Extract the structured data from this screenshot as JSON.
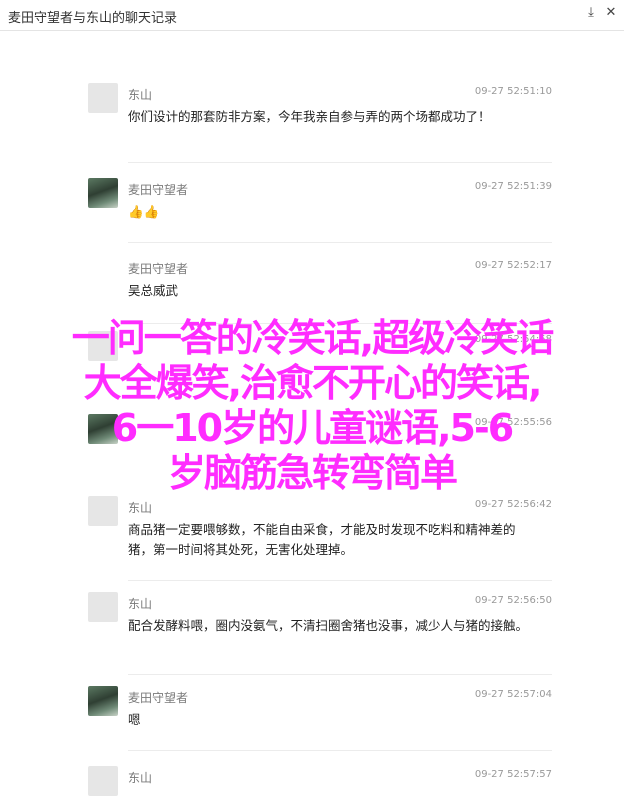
{
  "window": {
    "title": "麦田守望者与东山的聊天记录",
    "min_icon": "minimize-icon",
    "close_icon": "close-icon",
    "min_glyph": "⤓",
    "close_glyph": "✕"
  },
  "messages": [
    {
      "sender": "东山",
      "time": "09-27 52:51:10",
      "avatar": "default",
      "text": "你们设计的那套防非方案，今年我亲自参与弄的两个场都成功了！"
    },
    {
      "sender": "麦田守望者",
      "time": "09-27 52:51:39",
      "avatar": "photo",
      "text": "👍👍"
    },
    {
      "sender": "麦田守望者",
      "time": "09-27 52:52:17",
      "avatar": "none",
      "text": "吴总威武"
    },
    {
      "sender": "",
      "time": "09-27 52:54:58",
      "avatar": "default",
      "text": ""
    },
    {
      "sender": "",
      "time": "09-27 52:55:56",
      "avatar": "photo",
      "text": ""
    },
    {
      "sender": "东山",
      "time": "09-27 52:56:42",
      "avatar": "default",
      "text": "商品猪一定要喂够数，不能自由采食，才能及时发现不吃料和精神差的猪，第一时间将其处死，无害化处理掉。"
    },
    {
      "sender": "东山",
      "time": "09-27 52:56:50",
      "avatar": "default",
      "text": "配合发酵料喂，圈内没氨气，不清扫圈舍猪也没事，减少人与猪的接触。"
    },
    {
      "sender": "麦田守望者",
      "time": "09-27 52:57:04",
      "avatar": "photo",
      "text": "嗯"
    },
    {
      "sender": "东山",
      "time": "09-27 52:57:57",
      "avatar": "default",
      "text": ""
    }
  ],
  "overlay": {
    "lines": [
      "一问一答的冷笑话,超级冷笑话",
      "大全爆笑,治愈不开心的笑话,",
      "6一10岁的儿童谜语,5-6",
      "岁脑筋急转弯简单"
    ],
    "color": "#ff2cff"
  }
}
